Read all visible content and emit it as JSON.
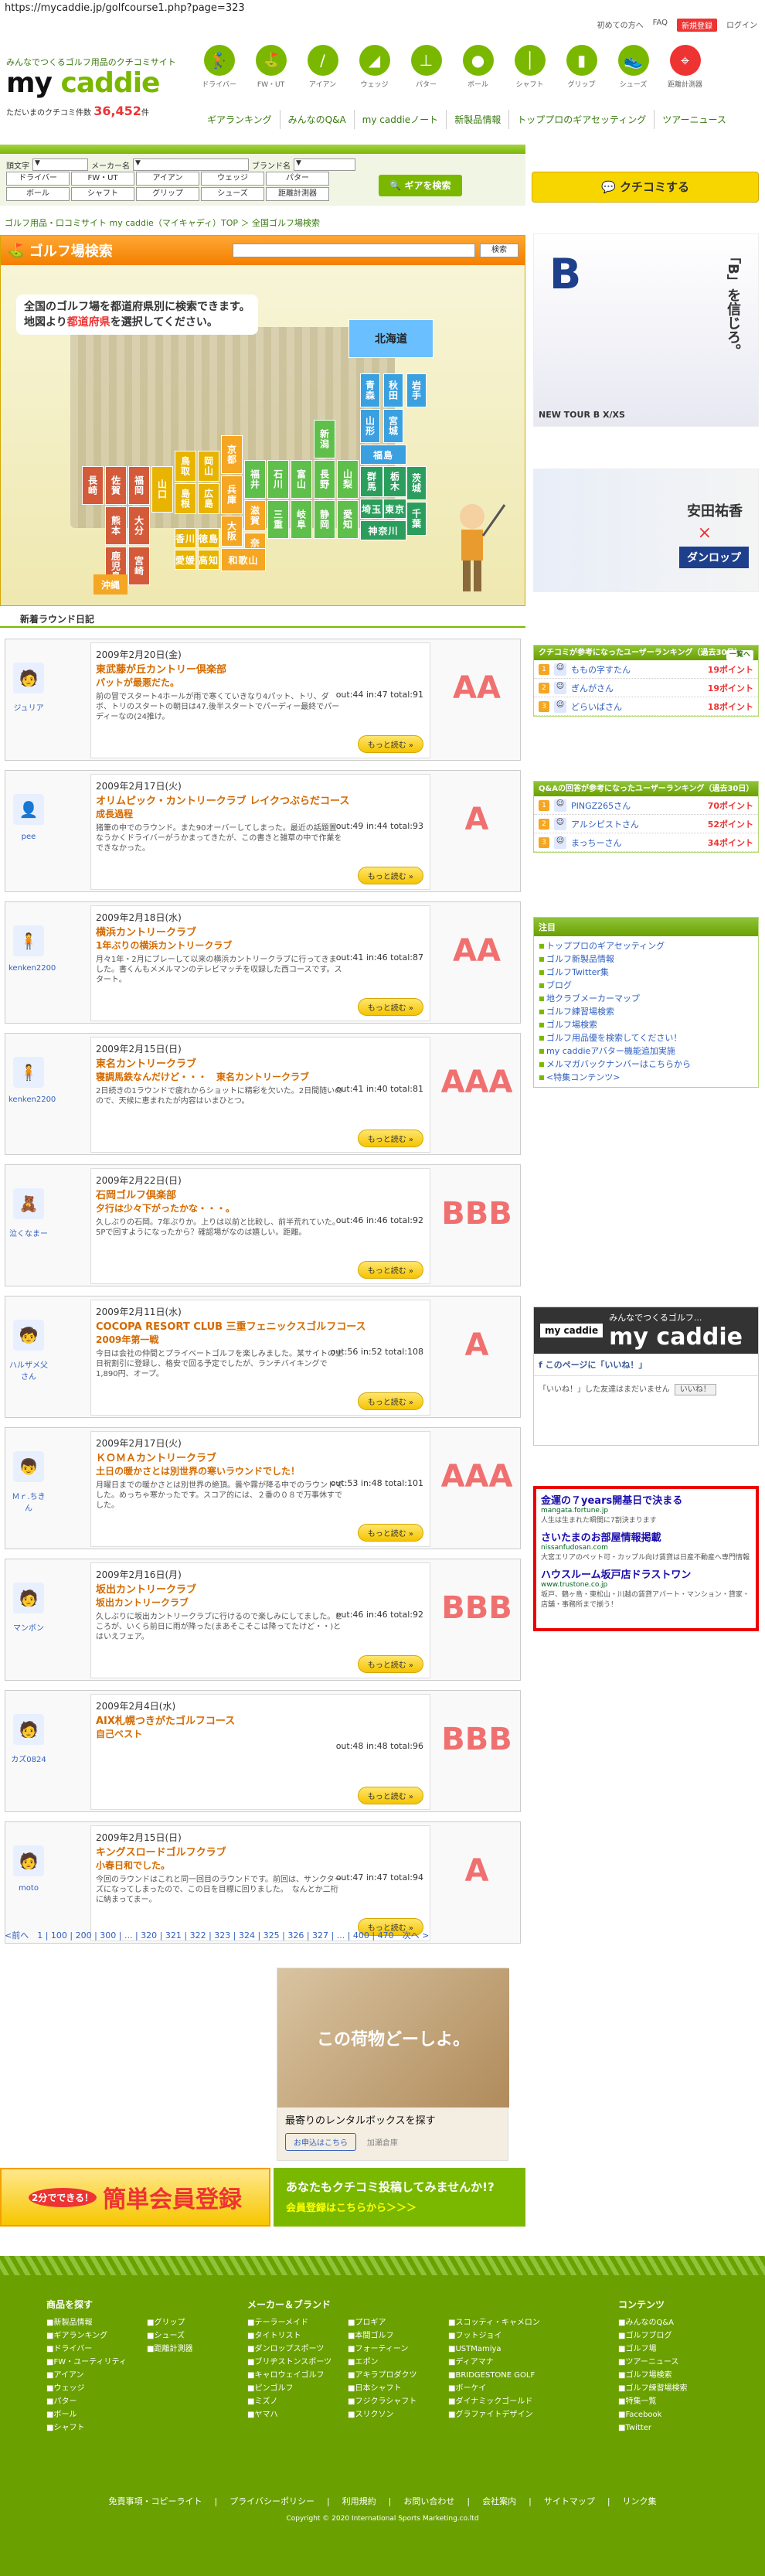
{
  "url": "https://mycaddie.jp/golfcourse1.php?page=323",
  "topnav": [
    "初めての方へ",
    "FAQ",
    "新規登録",
    "ログイン"
  ],
  "logo": {
    "tagline": "みんなでつくるゴルフ用品のクチコミサイト",
    "name1": "my ",
    "name2": "caddie",
    "count_label": "ただいまのクチコミ件数",
    "count": "36,452",
    "count_unit": "件"
  },
  "categories": [
    {
      "label": "ドライバー",
      "icon": "driver-icon"
    },
    {
      "label": "FW・UT",
      "icon": "fairway-wood-icon"
    },
    {
      "label": "アイアン",
      "icon": "iron-icon"
    },
    {
      "label": "ウェッジ",
      "icon": "wedge-icon"
    },
    {
      "label": "パター",
      "icon": "putter-icon"
    },
    {
      "label": "ボール",
      "icon": "ball-icon"
    },
    {
      "label": "シャフト",
      "icon": "shaft-icon"
    },
    {
      "label": "グリップ",
      "icon": "grip-icon"
    },
    {
      "label": "シューズ",
      "icon": "shoes-icon"
    },
    {
      "label": "距離計測器",
      "icon": "rangefinder-icon"
    }
  ],
  "mainnav": [
    "ギアランキング",
    "みんなのQ&A",
    "my caddieノート",
    "新製品情報",
    "トッププロのギアセッティング",
    "ツアーニュース"
  ],
  "search": {
    "label_kw": "頭文字",
    "label_maker": "メーカー名",
    "label_brand": "ブランド名",
    "keywords": [
      "ドライバー",
      "FW・UT",
      "アイアン",
      "ウェッジ",
      "パター",
      "ボール",
      "シャフト",
      "グリップ",
      "シューズ",
      "距離計測器"
    ],
    "button": "ギアを検索"
  },
  "kuchikomi_button": "クチコミする",
  "breadcrumb": "ゴルフ用品・口コミサイト my caddie（マイキャディ）TOP ＞ 全国ゴルフ場検索",
  "course_search": {
    "title": "ゴルフ場検索",
    "button": "検索",
    "text1": "全国のゴルフ場を都道府県別に検索できます。",
    "text2a": "地図より",
    "text2b": "都道府県",
    "text2c": "を選択してください。",
    "hokkaido": "北海道",
    "okinawa": "沖縄",
    "prefs": [
      "青森",
      "秋田",
      "岩手",
      "山形",
      "宮城",
      "福島",
      "群馬",
      "栃木",
      "茨城",
      "埼玉",
      "東京",
      "千葉",
      "神奈川",
      "新潟",
      "富山",
      "石川",
      "福井",
      "長野",
      "山梨",
      "岐阜",
      "静岡",
      "愛知",
      "三重",
      "滋賀",
      "京都",
      "兵庫",
      "大阪",
      "奈良",
      "和歌山",
      "鳥取",
      "島根",
      "岡山",
      "広島",
      "山口",
      "香川",
      "徳島",
      "愛媛",
      "高知",
      "福岡",
      "佐賀",
      "長崎",
      "大分",
      "熊本",
      "宮崎",
      "鹿児島"
    ]
  },
  "diary_section_title": "新着ラウンド日記",
  "diaries": [
    {
      "user": "ジュリア",
      "date": "2009年2月20日(金)",
      "course": "東武藤が丘カントリー倶楽部",
      "title": "パットが最悪だた。",
      "out": "out:44",
      "in": "in:47",
      "total": "total:91",
      "body": "前の冒でスタート4ホールが雨で寒くていきなり4パット、トリ、ダボ、トリのスタートの朝日は47.後半スタートでパーディー最終でパーディーなの(24推け。",
      "rank": "AA",
      "more": "もっと読む"
    },
    {
      "user": "pee",
      "date": "2009年2月17日(火)",
      "course": "オリムピック・カントリークラブ レイクつぶらだコース",
      "title": "成長過程",
      "out": "out:49",
      "in": "in:44",
      "total": "total:93",
      "body": "猪筆の中でのラウンド。また90オーバーしてしまった。最近の話題置なうかくドライバーがうかまってきたが、この書きと雑草の中で作業をできなかった。",
      "rank": "A",
      "more": "もっと読む"
    },
    {
      "user": "kenken2200",
      "date": "2009年2月18日(水)",
      "course": "横浜カントリークラブ",
      "title": "1年ぶりの横浜カントリークラブ",
      "out": "out:41",
      "in": "in:46",
      "total": "total:87",
      "body": "月々1年・2月にブレーして以来の横浜カントリークラブに行ってきました。書くんもメメルマンのテレビマッチを収録した西コースです。スタート。",
      "rank": "AA",
      "more": "もっと読む"
    },
    {
      "user": "kenken2200",
      "date": "2009年2月15日(日)",
      "course": "東名カントリークラブ",
      "title": "寝調馬鉄なんだけど・・・　東名カントリークラブ",
      "out": "out:41",
      "in": "in:40",
      "total": "total:81",
      "body": "2日続きの1ラウンドで疲れからショットに精彩を欠いた。2日間随いのので、天候に恵まれたが内容はいまひとつ。",
      "rank": "AAA",
      "more": "もっと読む"
    },
    {
      "user": "泣くなまー",
      "date": "2009年2月22日(日)",
      "course": "石岡ゴルフ倶楽部",
      "title": "夕行は少々下がったかな・・・。",
      "out": "out:46",
      "in": "in:46",
      "total": "total:92",
      "body": "久しぶりの石岡。7年ぶりか。上りは以前と比較し、前半荒れていた。5Pで回すようになったから？確認場がなのは嬉しい。距離。",
      "rank": "BBB",
      "more": "もっと読む"
    },
    {
      "user": "ハルザメ父さん",
      "date": "2009年2月11日(水)",
      "course": "COCOPA RESORT CLUB 三重フェニックスゴルフコース",
      "title": "2009年第一戦",
      "out": "out:56",
      "in": "in:52",
      "total": "total:108",
      "body": "今日は会社の仲間とプライベートゴルフを楽しみました。某サイトの土日祝割引に登録し、格安で回る予定でしたが、ランチバイキングで1,890円、オープ。",
      "rank": "A",
      "more": "もっと読む"
    },
    {
      "user": "Ｍｒ.ちきん",
      "date": "2009年2月17日(火)",
      "course": "ＫＯＭＡカントリークラブ",
      "title": "土日の暖かさとは別世界の寒いラウンドでした！",
      "out": "out:53",
      "in": "in:48",
      "total": "total:101",
      "body": "月曜日までの暖かさとは別世界の絶頂。曇や霧が降る中でのラウンドでした。めっちゃ寒かったです。スコア的には、２番の０８で万事休すでした。",
      "rank": "AAA",
      "more": "もっと読む"
    },
    {
      "user": "マンボン",
      "date": "2009年2月16日(月)",
      "course": "坂出カントリークラブ",
      "title": "坂出カントリークラブ",
      "out": "out:46",
      "in": "in:46",
      "total": "total:92",
      "body": "久しぶりに坂出カントリークラブに行けるので楽しみにしてました。ところが、いくら前日に雨が降った(まあそこそこは降ってたけど・・)とはいえフェア。",
      "rank": "BBB",
      "more": "もっと読む"
    },
    {
      "user": "カズ0824",
      "date": "2009年2月4日(水)",
      "course": "AIX札幌つきがたゴルフコース",
      "title": "自己ベスト",
      "out": "out:48",
      "in": "in:48",
      "total": "total:96",
      "body": "",
      "rank": "BBB",
      "more": "もっと読む"
    },
    {
      "user": "moto",
      "date": "2009年2月15日(日)",
      "course": "キングスロードゴルフクラブ",
      "title": "小春日和でした。",
      "out": "out:47",
      "in": "in:47",
      "total": "total:94",
      "body": "今回のラウンドはこれと同一回目のラウンドです。前回は、サンクターズになってしまったので、この日を目標に回りました。　なんとか二桁に納まってまー。",
      "rank": "A",
      "more": "もっと読む"
    }
  ],
  "pagination": "<前へ　1 | 100 | 200 | 300 | ... | 320 | 321 | 322 | 323 | 324 | 325 | 326 | 327 | ... | 400 | 470　次へ >",
  "ad_mid": {
    "photo_text": "この荷物どーしよ。",
    "title": "最寄りのレンタルボックスを探す",
    "button": "お申込はこちら",
    "company": "加瀬倉庫"
  },
  "register": {
    "left_small": "2分でできる！",
    "left": "簡単会員登録",
    "right1": "あなたもクチコミ投稿してみませんか!?",
    "right2": "会員登録はこちらから＞＞＞"
  },
  "right_ad1": {
    "text": "「B」を信じろ。",
    "caption": "NEW TOUR B X/XS"
  },
  "right_ad2": {
    "name": "安田祐香",
    "x": "×",
    "brand": "ダンロップ"
  },
  "rank1": {
    "title": "クチコミが参考になったユーザーランキング（過去30日）",
    "list": "一覧へ",
    "items": [
      {
        "name": "ももの字すたん",
        "pt": "19ポイント"
      },
      {
        "name": "ぎんがさん",
        "pt": "19ポイント"
      },
      {
        "name": "どらいばさん",
        "pt": "18ポイント"
      }
    ]
  },
  "rank2": {
    "title": "Q&Aの回答が参考になったユーザーランキング（過去30日）",
    "items": [
      {
        "name": "PINGZ265さん",
        "pt": "70ポイント"
      },
      {
        "name": "アルシピストさん",
        "pt": "52ポイント"
      },
      {
        "name": "まっちーさん",
        "pt": "34ポイント"
      }
    ]
  },
  "links": {
    "title": "注目",
    "items": [
      "トッププロのギアセッティング",
      "ゴルフ新製品情報",
      "ゴルフTwitter集",
      "ブログ",
      "地クラブメーカーマップ",
      "ゴルフ練習場検索",
      "ゴルフ場検索",
      "ゴルフ用品優を検索してください！",
      "my caddieアバター機能追加実施",
      "メルマガバックナンバーはこちらから",
      "<特集コンテンツ>"
    ]
  },
  "fb": {
    "banner_small": "my caddie",
    "banner": "みんなでつくるゴルフ...",
    "big": "my caddie",
    "line": "このページに「いいね！」",
    "like": "「いいね！」した友達はまだいません",
    "btn": "いいね！"
  },
  "ad_text": [
    {
      "title": "金運の７years開基日で決まる",
      "domain": "mangata.fortune.jp",
      "body": "人生は生まれた瞬間に7割決まります"
    },
    {
      "title": "さいたまのお部屋情報掲載",
      "domain": "nissanfudosan.com",
      "body": "大宮エリアのペット可・カップル向け賃貸は日産不動産へ専門情報"
    },
    {
      "title": "ハウスルーム坂戸店ドラストワン",
      "domain": "www.trustone.co.jp",
      "body": "坂戸、鶴ヶ島・東松山・川越の賃貸アパート・マンション・貸家・店舗・事務所まで揃う！"
    }
  ],
  "footer": {
    "col1_title": "商品を探す",
    "col1": [
      "新製品情報",
      "ギアランキング",
      "ドライバー",
      "FW・ユーティリティ",
      "アイアン",
      "ウェッジ",
      "パター",
      "ボール",
      "シャフト"
    ],
    "col2": [
      "グリップ",
      "シューズ",
      "距離計測器"
    ],
    "col3_title": "メーカー＆ブランド",
    "col3": [
      "テーラーメイド",
      "タイトリスト",
      "ダンロップスポーツ",
      "ブリヂストンスポーツ",
      "キャロウェイゴルフ",
      "ピンゴルフ",
      "ミズノ",
      "ヤマハ"
    ],
    "col4": [
      "プロギア",
      "本間ゴルフ",
      "フォーティーン",
      "エポン",
      "アキラプロダクツ",
      "日本シャフト",
      "フジクラシャフト",
      "スリクソン"
    ],
    "col5": [
      "スコッティ・キャメロン",
      "フットジョイ",
      "USTMamiya",
      "ディアマナ",
      "BRIDGESTONE GOLF",
      "ボーケイ",
      "ダイナミックゴールド",
      "グラファイトデザイン"
    ],
    "col6_title": "コンテンツ",
    "col6": [
      "みんなのQ&A",
      "ゴルフブログ",
      "ゴルフ場",
      "ツアーニュース",
      "ゴルフ場検索",
      "ゴルフ練習場検索",
      "特集一覧",
      "Facebook",
      "Twitter"
    ],
    "bottom": [
      "免責事項・コピーライト",
      "プライバシーポリシー",
      "利用規約",
      "お問い合わせ",
      "会社案内",
      "サイトマップ",
      "リンク集"
    ],
    "copy": "Copyright © 2020 International Sports Marketing.co.ltd"
  }
}
